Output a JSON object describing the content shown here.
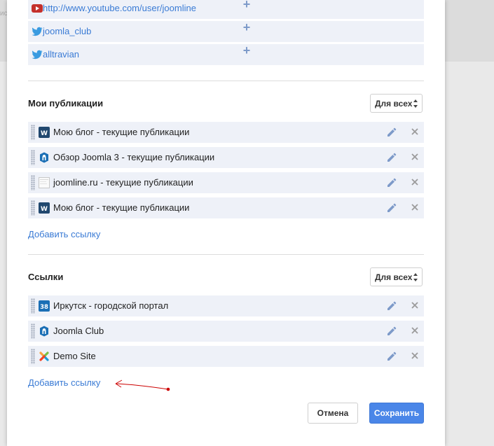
{
  "background": {
    "ghost_text": "ис"
  },
  "social_links": [
    {
      "icon": "youtube-icon",
      "label": "http://www.youtube.com/user/joomline",
      "add_symbol": "+"
    },
    {
      "icon": "twitter-icon",
      "label": "joomla_club",
      "add_symbol": "+"
    },
    {
      "icon": "twitter-icon",
      "label": "alltravian",
      "add_symbol": "+"
    }
  ],
  "publications": {
    "title": "Мои публикации",
    "visibility": "Для всех",
    "items": [
      {
        "icon": "wordpress-icon",
        "label": "Мою блог - текущие публикации"
      },
      {
        "icon": "joomla-blue-icon",
        "label": "Обзор Joomla 3 - текущие публикации"
      },
      {
        "icon": "page-icon",
        "label": "joomline.ru - текущие публикации"
      },
      {
        "icon": "wordpress-icon",
        "label": "Мою блог - текущие публикации"
      }
    ],
    "add_link": "Добавить ссылку"
  },
  "links": {
    "title": "Ссылки",
    "visibility": "Для всех",
    "items": [
      {
        "icon": "irk-38-icon",
        "icon_text": "38",
        "label": "Иркутск - городской портал"
      },
      {
        "icon": "joomla-blue-icon",
        "label": "Joomla Club"
      },
      {
        "icon": "joomla-logo-icon",
        "label": "Demo Site"
      }
    ],
    "add_link": "Добавить ссылку"
  },
  "footer": {
    "cancel_label": "Отмена",
    "save_label": "Сохранить"
  },
  "colors": {
    "link": "#3a7bd5",
    "row_bg": "#eef1f8",
    "primary": "#4a86e8",
    "annotation": "#cc0000"
  }
}
